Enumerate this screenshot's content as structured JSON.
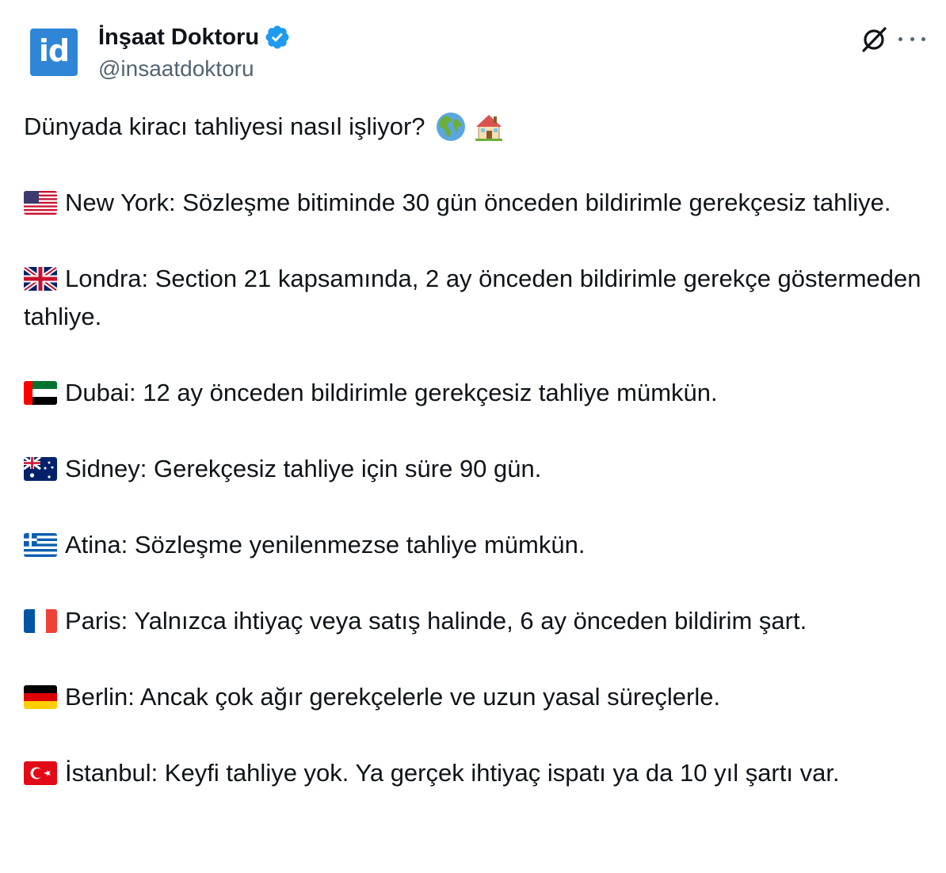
{
  "author": {
    "display_name": "İnşaat Doktoru",
    "handle": "@insaatdoktoru",
    "avatar_text": "id",
    "verified": true,
    "verified_color": "#1d9bf0",
    "avatar_color": "#2f86d6"
  },
  "actions": {
    "grok_icon": "grok-icon",
    "more_icon": "more-icon"
  },
  "tweet": {
    "intro": "Dünyada kiracı tahliyesi nasıl işliyor?",
    "intro_emojis": [
      "globe-africa-emoji",
      "house-emoji"
    ],
    "entries": [
      {
        "flag": "us-flag",
        "text": "New York: Sözleşme bitiminde 30 gün önceden bildirimle gerekçesiz tahliye."
      },
      {
        "flag": "uk-flag",
        "text": "Londra: Section 21 kapsamında, 2 ay önceden bildirimle gerekçe göstermeden tahliye."
      },
      {
        "flag": "uae-flag",
        "text": "Dubai: 12 ay önceden bildirimle gerekçesiz tahliye mümkün."
      },
      {
        "flag": "australia-flag",
        "text": "Sidney: Gerekçesiz tahliye için süre 90 gün."
      },
      {
        "flag": "greece-flag",
        "text": "Atina: Sözleşme yenilenmezse tahliye mümkün."
      },
      {
        "flag": "france-flag",
        "text": "Paris: Yalnızca ihtiyaç veya satış halinde, 6 ay önceden bildirim şart."
      },
      {
        "flag": "germany-flag",
        "text": "Berlin: Ancak çok ağır gerekçelerle ve uzun yasal süreçlerle."
      },
      {
        "flag": "turkey-flag",
        "text": "İstanbul: Keyfi tahliye yok. Ya gerçek ihtiyaç ispatı ya da 10 yıl şartı var."
      }
    ]
  }
}
